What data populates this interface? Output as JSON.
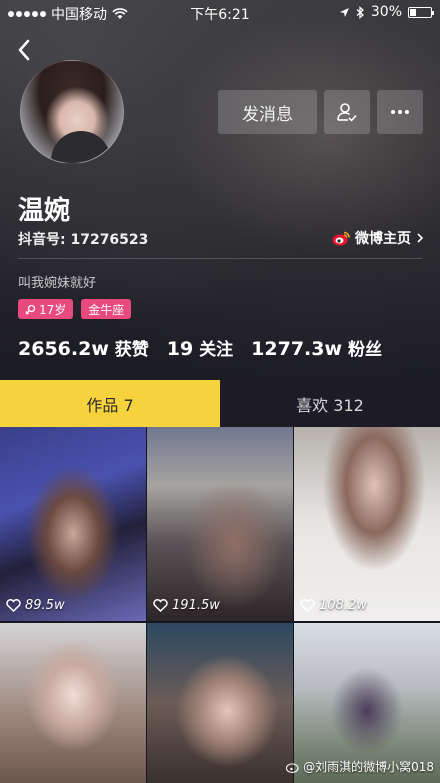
{
  "status_bar": {
    "carrier": "中国移动",
    "time": "下午6:21",
    "battery": "30%",
    "battery_level": 0.3
  },
  "profile": {
    "name": "温婉",
    "douyin_id": "抖音号: 17276523",
    "weibo_link": "微博主页",
    "bio": "叫我婉妹就好",
    "tags": [
      {
        "icon": "female-icon",
        "label": "17岁"
      },
      {
        "label": "金牛座"
      }
    ],
    "stats": [
      {
        "value": "2656.2w",
        "label": "获赞"
      },
      {
        "value": "19",
        "label": "关注"
      },
      {
        "value": "1277.3w",
        "label": "粉丝"
      }
    ]
  },
  "actions": {
    "message": "发消息"
  },
  "tabs": [
    {
      "label": "作品 7",
      "active": true
    },
    {
      "label": "喜欢 312",
      "active": false
    }
  ],
  "videos": [
    {
      "likes": "89.5w"
    },
    {
      "likes": "191.5w"
    },
    {
      "likes": "108.2w"
    },
    {
      "likes": ""
    },
    {
      "likes": ""
    },
    {
      "likes": ""
    }
  ],
  "watermark": "@刘雨淇的微博小窝018",
  "colors": {
    "accent_yellow": "#f6d33d",
    "tag_pink": "#e84a7d",
    "weibo_orange": "#f5a623"
  }
}
